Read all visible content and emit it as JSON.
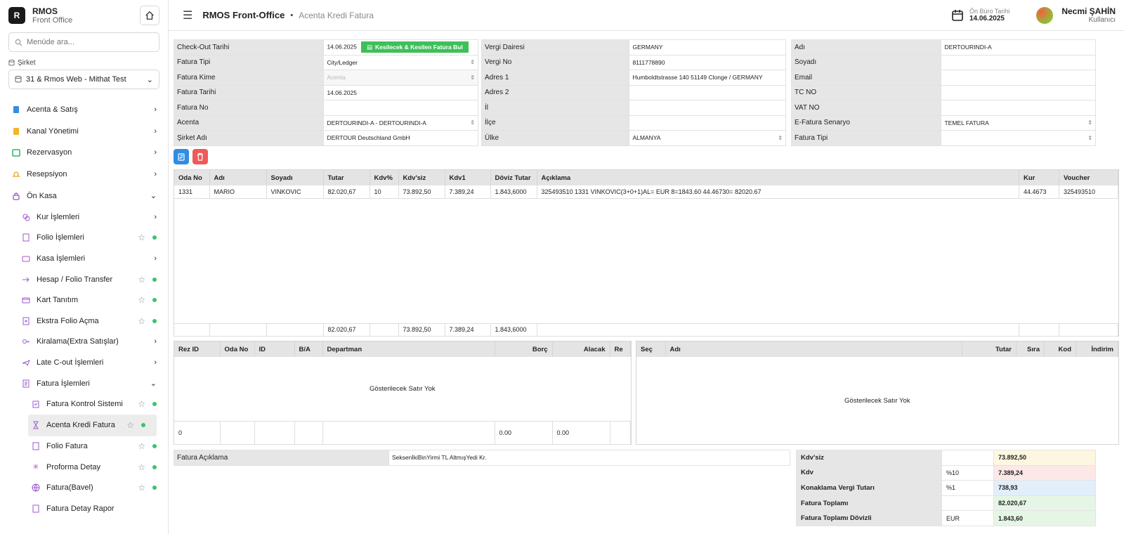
{
  "brand": {
    "logo_letter": "R",
    "title": "RMOS",
    "subtitle": "Front Office"
  },
  "sidebar": {
    "search_placeholder": "Menüde ara...",
    "company_label": "Şirket",
    "company_value": "31 & Rmos Web - Mithat Test",
    "items": [
      {
        "label": "Acenta & Satış",
        "icon": "book-icon"
      },
      {
        "label": "Kanal Yönetimi",
        "icon": "channel-icon"
      },
      {
        "label": "Rezervasyon",
        "icon": "calendar-icon"
      },
      {
        "label": "Resepsiyon",
        "icon": "bell-icon"
      },
      {
        "label": "Ön Kasa",
        "icon": "lock-icon"
      },
      {
        "label": "Kur İşlemleri",
        "icon": "coins-icon"
      },
      {
        "label": "Folio İşlemleri",
        "icon": "folio-icon"
      },
      {
        "label": "Kasa İşlemleri",
        "icon": "wallet-icon"
      },
      {
        "label": "Hesap / Folio Transfer",
        "icon": "arrow-right-icon"
      },
      {
        "label": "Kart Tanıtım",
        "icon": "card-icon"
      },
      {
        "label": "Ekstra Folio Açma",
        "icon": "add-file-icon"
      },
      {
        "label": "Kiralama(Extra Satışlar)",
        "icon": "key-icon"
      },
      {
        "label": "Late C-out İşlemleri",
        "icon": "plane-icon"
      },
      {
        "label": "Fatura İşlemleri",
        "icon": "invoice-icon"
      },
      {
        "label": "Fatura Kontrol Sistemi",
        "icon": "clipboard-icon"
      },
      {
        "label": "Acenta Kredi Fatura",
        "icon": "hourglass-icon"
      },
      {
        "label": "Folio Fatura",
        "icon": "receipt-icon"
      },
      {
        "label": "Proforma Detay",
        "icon": "sparkle-icon"
      },
      {
        "label": "Fatura(Bavel)",
        "icon": "globe-icon"
      },
      {
        "label": "Fatura Detay Rapor",
        "icon": "report-icon"
      }
    ]
  },
  "topbar": {
    "app_title": "RMOS Front-Office",
    "separator": "•",
    "page": "Acenta Kredi Fatura",
    "date_label": "Ön Büro Tarihi",
    "date_value": "14.06.2025",
    "user_name": "Necmi ŞAHİN",
    "user_role": "Kullanıcı"
  },
  "form_left": {
    "checkout_label": "Check-Out Tarihi",
    "checkout_value": "14.06.2025",
    "find_button": "Kesilecek & Kesilen Fatura Bul",
    "invoice_type_label": "Fatura Tipi",
    "invoice_type_value": "City/Ledger",
    "invoice_to_label": "Fatura Kime",
    "invoice_to_value": "Acenta",
    "invoice_date_label": "Fatura Tarihi",
    "invoice_date_value": "14.06.2025",
    "invoice_no_label": "Fatura No",
    "invoice_no_value": "",
    "agency_label": "Acenta",
    "agency_value": "DERTOURINDI-A - DERTOURINDI-A",
    "company_name_label": "Şirket Adı",
    "company_name_value": "DERTOUR Deutschland GmbH"
  },
  "form_mid": {
    "tax_office_label": "Vergi Dairesi",
    "tax_office_value": "GERMANY",
    "tax_no_label": "Vergi No",
    "tax_no_value": "8111778890",
    "address1_label": "Adres 1",
    "address1_value": "Humboldtstrasse 140 51149 Clonge / GERMANY",
    "address2_label": "Adres 2",
    "address2_value": "",
    "city_label": "İl",
    "city_value": "",
    "district_label": "İlçe",
    "district_value": "",
    "country_label": "Ülke",
    "country_value": "ALMANYA"
  },
  "form_right": {
    "name_label": "Adı",
    "name_value": "DERTOURINDI-A",
    "surname_label": "Soyadı",
    "surname_value": "",
    "email_label": "Email",
    "email_value": "",
    "tcno_label": "TC NO",
    "tcno_value": "",
    "vatno_label": "VAT NO",
    "vatno_value": "",
    "escenario_label": "E-Fatura Senaryo",
    "escenario_value": "TEMEL FATURA",
    "invtype_label": "Fatura Tipi",
    "invtype_value": ""
  },
  "main_grid": {
    "headers": [
      "Oda No",
      "Adı",
      "Soyadı",
      "Tutar",
      "Kdv%",
      "Kdv'siz",
      "Kdv1",
      "Döviz Tutar",
      "Açıklama",
      "Kur",
      "Voucher"
    ],
    "rows": [
      [
        "1331",
        "MARIO",
        "VINKOVIC",
        "82.020,67",
        "10",
        "73.892,50",
        "7.389,24",
        "1.843,6000",
        "325493510 1331 VINKOVIC(3+0+1)AL= EUR 8=1843.60 44.46730= 82020.67",
        "44.4673",
        "325493510"
      ]
    ],
    "totals": [
      "",
      "",
      "",
      "82.020,67",
      "",
      "73.892,50",
      "7.389,24",
      "1.843,6000",
      "",
      "",
      ""
    ]
  },
  "bottom_left_grid": {
    "headers": [
      "Rez ID",
      "Oda No",
      "ID",
      "B/A",
      "Departman",
      "Borç",
      "Alacak",
      "Re"
    ],
    "empty_message": "Gösterilecek Satır Yok",
    "totals": [
      "0",
      "",
      "",
      "",
      "",
      "0.00",
      "0.00",
      ""
    ]
  },
  "bottom_right_grid": {
    "headers": [
      "Seç",
      "Adı",
      "Tutar",
      "Sıra",
      "Kod",
      "İndirim"
    ],
    "empty_message": "Gösterilecek Satır Yok"
  },
  "description": {
    "label": "Fatura Açıklama",
    "value": "SeksenİkiBinYirmi TL AltmışYedi Kr."
  },
  "summary": [
    {
      "label": "Kdv'siz",
      "rate": "",
      "value": "73.892,50",
      "color": "#fdf6e0"
    },
    {
      "label": "Kdv",
      "rate": "%10",
      "value": "7.389,24",
      "color": "#fde8e8"
    },
    {
      "label": "Konaklama Vergi Tutarı",
      "rate": "%1",
      "value": "738,93",
      "color": "#e3eefb"
    },
    {
      "label": "Fatura Toplamı",
      "rate": "",
      "value": "82.020,67",
      "color": "#e6f6e6"
    },
    {
      "label": "Fatura Toplamı Dövizli",
      "rate": "EUR",
      "value": "1.843,60",
      "color": "#e6f6e6"
    }
  ],
  "colors": {
    "accent_green": "#3fbf5a",
    "accent_blue": "#2f8de4",
    "accent_red": "#ee5a5a",
    "dot_green": "#3ac56a"
  }
}
